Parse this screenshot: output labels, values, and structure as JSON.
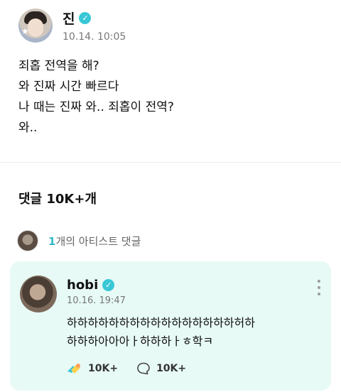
{
  "post": {
    "author": "진",
    "timestamp": "10.14. 10:05",
    "lines": [
      "죄홉 전역을 해?",
      "와 진짜 시간 빠르다",
      "나 때는 진짜 와.. 죄홉이 전역?",
      "와.."
    ]
  },
  "comments_section": {
    "title": "댓글 10K+개",
    "artist_count": "1",
    "artist_label": "개의 아티스트 댓글"
  },
  "comment": {
    "author": "hobi",
    "timestamp": "10.16. 19:47",
    "lines": [
      "하하하하하하하하하하하하하하하하허하",
      "하하하아아아ㅏ하하하ㅏㅎ학ㅋ"
    ],
    "like_count": "10K+",
    "reply_count": "10K+"
  },
  "colors": {
    "accent": "#38c7d6",
    "card_bg": "#e7faf6"
  },
  "icons": [
    "verified-badge-icon",
    "more-vertical-icon",
    "like-icon",
    "comment-bubble-icon"
  ]
}
